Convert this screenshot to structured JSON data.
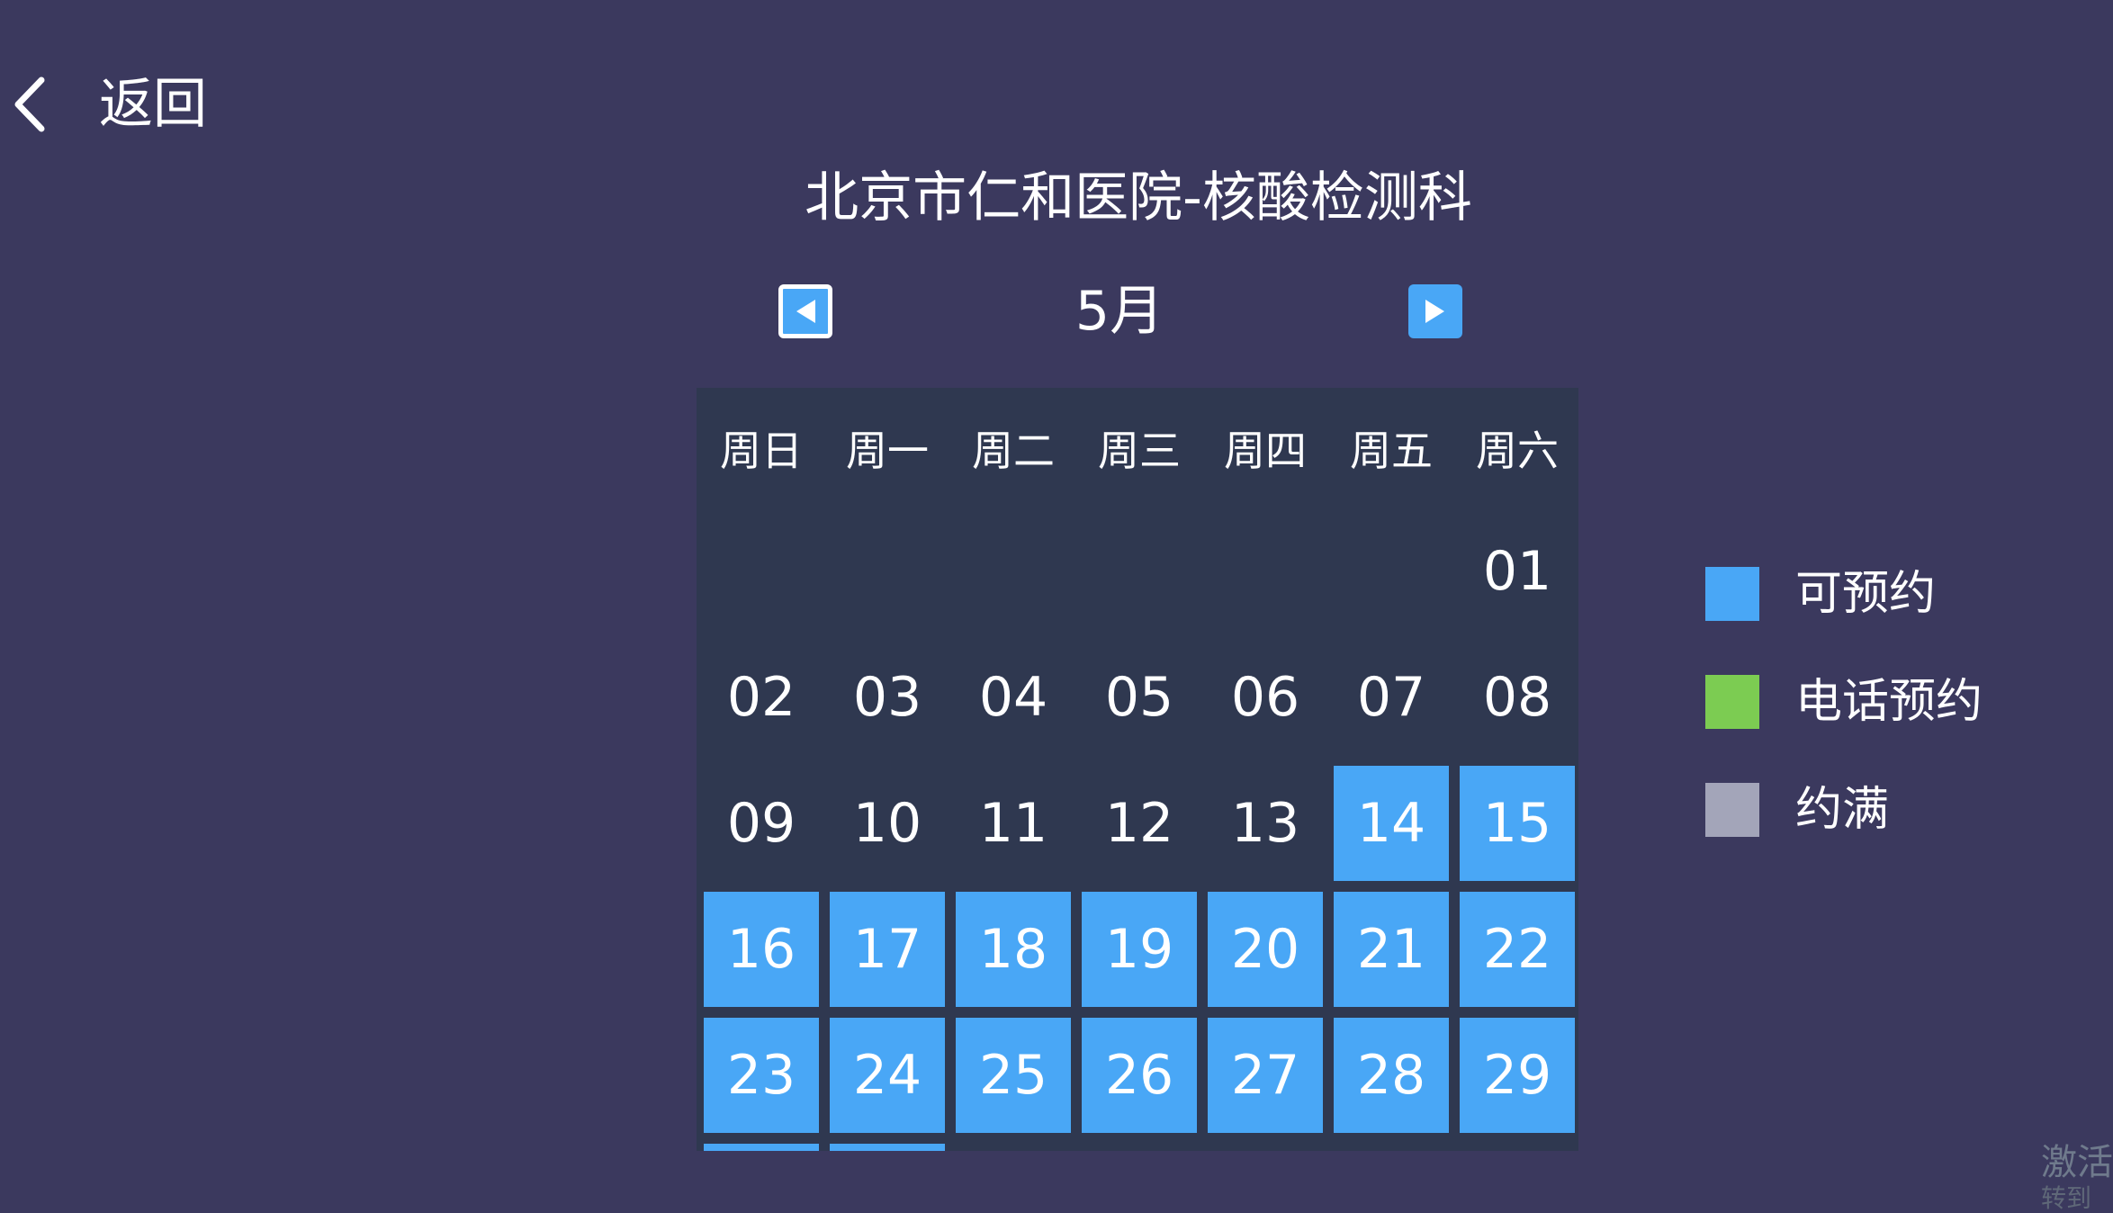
{
  "header": {
    "back_label": "返回"
  },
  "title": "北京市仁和医院-核酸检测科",
  "month_nav": {
    "month_label": "5月"
  },
  "calendar": {
    "weekdays": [
      "周日",
      "周一",
      "周二",
      "周三",
      "周四",
      "周五",
      "周六"
    ],
    "days": [
      {
        "label": "",
        "status": "empty"
      },
      {
        "label": "",
        "status": "empty"
      },
      {
        "label": "",
        "status": "empty"
      },
      {
        "label": "",
        "status": "empty"
      },
      {
        "label": "",
        "status": "empty"
      },
      {
        "label": "",
        "status": "empty"
      },
      {
        "label": "01",
        "status": "none"
      },
      {
        "label": "02",
        "status": "none"
      },
      {
        "label": "03",
        "status": "none"
      },
      {
        "label": "04",
        "status": "none"
      },
      {
        "label": "05",
        "status": "none"
      },
      {
        "label": "06",
        "status": "none"
      },
      {
        "label": "07",
        "status": "none"
      },
      {
        "label": "08",
        "status": "none"
      },
      {
        "label": "09",
        "status": "none"
      },
      {
        "label": "10",
        "status": "none"
      },
      {
        "label": "11",
        "status": "none"
      },
      {
        "label": "12",
        "status": "none"
      },
      {
        "label": "13",
        "status": "none"
      },
      {
        "label": "14",
        "status": "available"
      },
      {
        "label": "15",
        "status": "available"
      },
      {
        "label": "16",
        "status": "available"
      },
      {
        "label": "17",
        "status": "available"
      },
      {
        "label": "18",
        "status": "available"
      },
      {
        "label": "19",
        "status": "available"
      },
      {
        "label": "20",
        "status": "available"
      },
      {
        "label": "21",
        "status": "available"
      },
      {
        "label": "22",
        "status": "available"
      },
      {
        "label": "23",
        "status": "available"
      },
      {
        "label": "24",
        "status": "available"
      },
      {
        "label": "25",
        "status": "available"
      },
      {
        "label": "26",
        "status": "available"
      },
      {
        "label": "27",
        "status": "available"
      },
      {
        "label": "28",
        "status": "available"
      },
      {
        "label": "29",
        "status": "available"
      },
      {
        "label": "",
        "status": "available"
      },
      {
        "label": "",
        "status": "available"
      }
    ]
  },
  "legend": {
    "items": [
      {
        "label": "可预约",
        "color": "#49a7f6"
      },
      {
        "label": "电话预约",
        "color": "#7ccc52"
      },
      {
        "label": "约满",
        "color": "#a3a5b9"
      }
    ]
  },
  "watermark": {
    "line1": "激活",
    "line2": "转到"
  },
  "colors": {
    "background": "#3b395e",
    "calendar_panel": "#2f3850",
    "available": "#49a7f6"
  }
}
